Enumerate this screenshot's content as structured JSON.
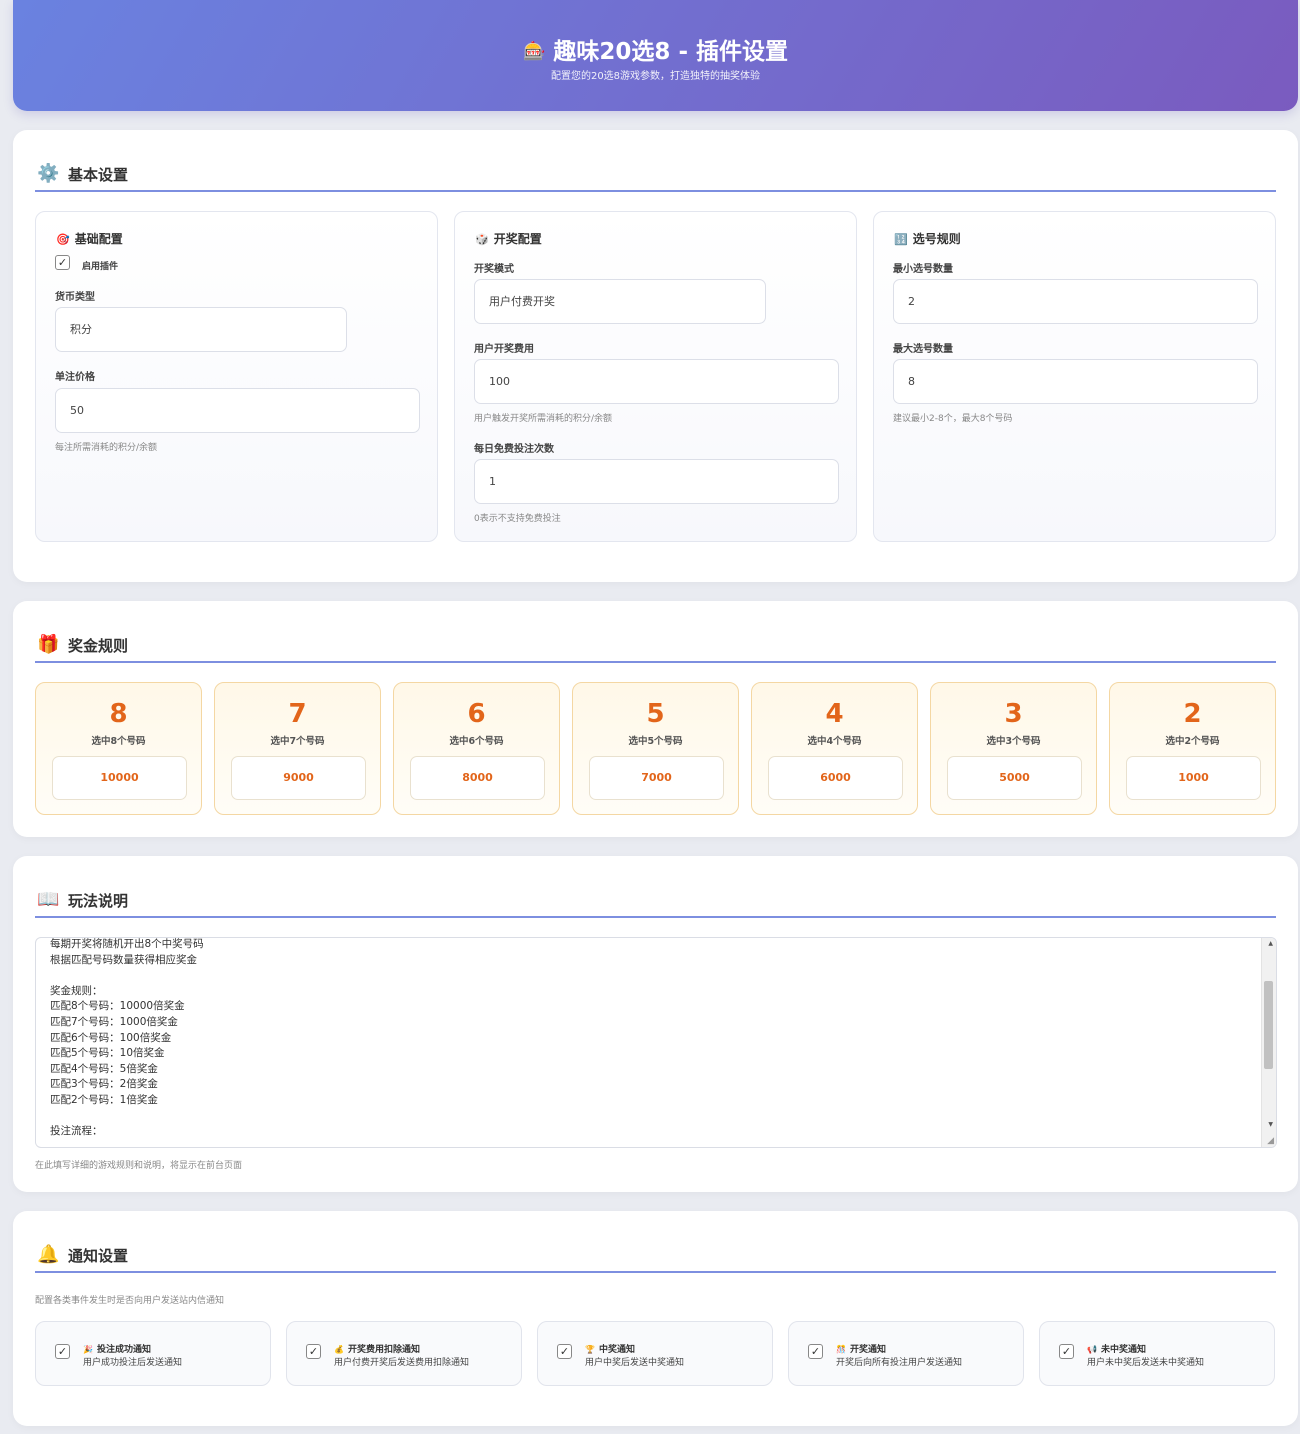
{
  "header": {
    "icon": "🎰",
    "title": "趣味20选8 - 插件设置",
    "subtitle": "配置您的20选8游戏参数，打造独特的抽奖体验"
  },
  "basic": {
    "title": "基本设置",
    "icon": "⚙️",
    "panels": [
      {
        "title": "基础配置",
        "icon": "🎯",
        "enable_label": "启用插件",
        "enabled": true,
        "currency_label": "货币类型",
        "currency_value": "积分",
        "price_label": "单注价格",
        "price_value": "50",
        "price_hint": "每注所需消耗的积分/余额"
      },
      {
        "title": "开奖配置",
        "icon": "🎲",
        "mode_label": "开奖模式",
        "mode_value": "用户付费开奖",
        "fee_label": "用户开奖费用",
        "fee_value": "100",
        "fee_hint": "用户触发开奖所需消耗的积分/余额",
        "free_label": "每日免费投注次数",
        "free_value": "1",
        "free_hint": "0表示不支持免费投注"
      },
      {
        "title": "选号规则",
        "icon": "🔢",
        "min_label": "最小选号数量",
        "min_value": "2",
        "max_label": "最大选号数量",
        "max_value": "8",
        "hint": "建议最小2-8个，最大8个号码"
      }
    ]
  },
  "prizes": {
    "title": "奖金规则",
    "icon": "🎁",
    "items": [
      {
        "count": "8",
        "caption": "选中8个号码",
        "value": "10000"
      },
      {
        "count": "7",
        "caption": "选中7个号码",
        "value": "9000"
      },
      {
        "count": "6",
        "caption": "选中6个号码",
        "value": "8000"
      },
      {
        "count": "5",
        "caption": "选中5个号码",
        "value": "7000"
      },
      {
        "count": "4",
        "caption": "选中4个号码",
        "value": "6000"
      },
      {
        "count": "3",
        "caption": "选中3个号码",
        "value": "5000"
      },
      {
        "count": "2",
        "caption": "选中2个号码",
        "value": "1000"
      }
    ]
  },
  "howto": {
    "title": "玩法说明",
    "icon": "📖",
    "lines": [
      "每期开奖将随机开出8个中奖号码",
      "根据匹配号码数量获得相应奖金",
      "",
      "奖金规则：",
      "匹配8个号码：10000倍奖金",
      "匹配7个号码：1000倍奖金",
      "匹配6个号码：100倍奖金",
      "匹配5个号码：10倍奖金",
      "匹配4个号码：5倍奖金",
      "匹配3个号码：2倍奖金",
      "匹配2个号码：1倍奖金",
      "",
      "投注流程："
    ],
    "hint": "在此填写详细的游戏规则和说明，将显示在前台页面"
  },
  "notify": {
    "title": "通知设置",
    "icon": "🔔",
    "desc": "配置各类事件发生时是否向用户发送站内信通知",
    "items": [
      {
        "icon": "🎉",
        "title": "投注成功通知",
        "desc": "用户成功投注后发送通知",
        "checked": true
      },
      {
        "icon": "💰",
        "title": "开奖费用扣除通知",
        "desc": "用户付费开奖后发送费用扣除通知",
        "checked": true
      },
      {
        "icon": "🏆",
        "title": "中奖通知",
        "desc": "用户中奖后发送中奖通知",
        "checked": true
      },
      {
        "icon": "🎊",
        "title": "开奖通知",
        "desc": "开奖后向所有投注用户发送通知",
        "checked": true
      },
      {
        "icon": "📢",
        "title": "未中奖通知",
        "desc": "用户未中奖后发送未中奖通知",
        "checked": true
      }
    ]
  }
}
